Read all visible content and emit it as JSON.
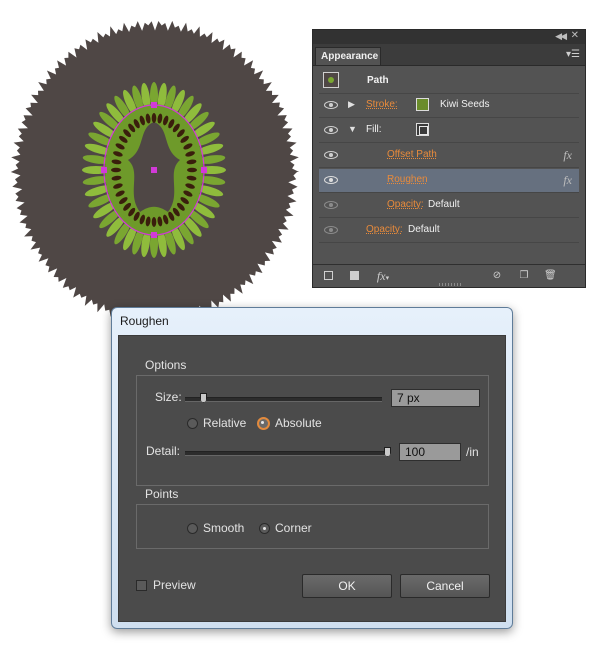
{
  "artwork": {
    "colors": {
      "background_disc": "#4f4745",
      "leaves": "#7aa631",
      "seeds": "#3a1e0c",
      "path_outline": "#d23ad8"
    }
  },
  "appearance_panel": {
    "tab_label": "Appearance",
    "collapse_icon": "double-chevron-left-icon",
    "close_icon": "close-icon",
    "menu_icon": "panel-menu-icon",
    "header": {
      "label": "Path"
    },
    "rows": {
      "stroke": {
        "label": "Stroke:",
        "value": "Kiwi Seeds",
        "swatch_color": "#6a8c2b"
      },
      "fill": {
        "label": "Fill:"
      },
      "offset_path": {
        "label": "Offset Path",
        "badge": "fx"
      },
      "roughen": {
        "label": "Roughen",
        "badge": "fx"
      },
      "fill_opacity": {
        "label": "Opacity:",
        "value": "Default"
      },
      "opacity": {
        "label": "Opacity:",
        "value": "Default"
      }
    },
    "bottom_toolbar": {
      "fx_label": "fx",
      "icons": [
        "new-stroke-icon",
        "new-fill-icon",
        "add-effect-icon",
        "clear-appearance-icon",
        "duplicate-item-icon",
        "delete-item-icon"
      ]
    },
    "colors": {
      "panel_bg": "#535353",
      "selected_row": "#66707f",
      "link_text": "#e98b3b"
    }
  },
  "dialog": {
    "title": "Roughen",
    "options": {
      "title": "Options",
      "size_label": "Size:",
      "size_value": "7 px",
      "size_slider_fraction": 0.07,
      "relative_label": "Relative",
      "absolute_label": "Absolute",
      "selected_mode": "Absolute",
      "detail_label": "Detail:",
      "detail_value": "100",
      "detail_unit": "/in",
      "detail_slider_fraction": 1.0
    },
    "points": {
      "title": "Points",
      "smooth_label": "Smooth",
      "corner_label": "Corner",
      "selected": "Corner"
    },
    "preview_label": "Preview",
    "preview_checked": false,
    "ok_label": "OK",
    "cancel_label": "Cancel",
    "colors": {
      "body_bg": "#4b4b4b",
      "title_bar": "#d7e5f4",
      "radio_accent": "#e28a3d"
    }
  }
}
